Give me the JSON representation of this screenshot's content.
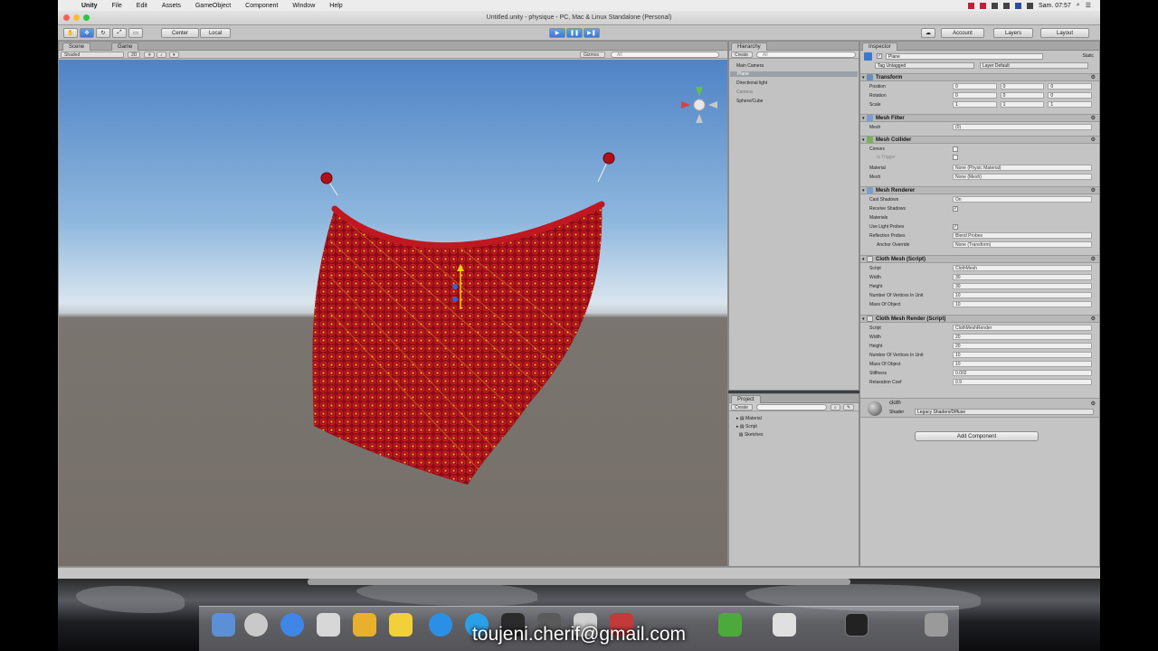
{
  "menubar": {
    "apple": "",
    "app_name": "Unity",
    "items": [
      "File",
      "Edit",
      "Assets",
      "GameObject",
      "Component",
      "Window",
      "Help"
    ],
    "clock": "Sam. 07:57"
  },
  "window": {
    "title": "Untitled.unity - physique - PC, Mac & Linux Standalone (Personal)"
  },
  "toolbar": {
    "tool_hand": "✋",
    "tool_move": "✥",
    "tool_rotate": "↻",
    "tool_scale": "⤢",
    "tool_rect": "▭",
    "pivot": "Center",
    "space": "Local",
    "play": "▶",
    "pause": "❚❚",
    "step": "▶❚",
    "cloud": "☁",
    "account": "Account",
    "layers": "Layers",
    "layout": "Layout"
  },
  "scene": {
    "tab_scene": "Scene",
    "tab_game": "Game",
    "shading": "Shaded",
    "mode_2d": "2D",
    "gizmos": "Gizmos",
    "search_placeholder": "All"
  },
  "hierarchy": {
    "tab": "Hierarchy",
    "create": "Create",
    "search_placeholder": "All",
    "items": [
      {
        "label": "Main Camera",
        "state": "normal"
      },
      {
        "label": "Plane",
        "state": "selected"
      },
      {
        "label": "Directional light",
        "state": "normal"
      },
      {
        "label": "Camera",
        "state": "dim"
      },
      {
        "label": "Sphere/Cube",
        "state": "normal"
      }
    ]
  },
  "project": {
    "tab": "Project",
    "create": "Create",
    "search_placeholder": "",
    "items": [
      "Material",
      "Script",
      "Sketches"
    ]
  },
  "inspector": {
    "tab": "Inspector",
    "object_name": "Plane",
    "static": "Static",
    "tag": "Tag Untagged",
    "layer": "Layer Default",
    "transform": {
      "title": "Transform",
      "position": {
        "label": "Position",
        "x": "0",
        "y": "0",
        "z": "0"
      },
      "rotation": {
        "label": "Rotation",
        "x": "0",
        "y": "0",
        "z": "0"
      },
      "scale": {
        "label": "Scale",
        "x": "1",
        "y": "1",
        "z": "1"
      }
    },
    "mesh_filter": {
      "title": "Mesh Filter",
      "mesh_label": "Mesh",
      "mesh_value": "(0)"
    },
    "mesh_collider": {
      "title": "Mesh Collider",
      "convex": "Convex",
      "trigger": "Is Trigger",
      "material_label": "Material",
      "material_value": "None (Physic Material)",
      "mesh_label": "Mesh",
      "mesh_value": "None (Mesh)"
    },
    "mesh_renderer": {
      "title": "Mesh Renderer",
      "cast_shadows_label": "Cast Shadows",
      "cast_shadows_value": "On",
      "receive_shadows": "Receive Shadows",
      "materials": "Materials",
      "light_probes": "Use Light Probes",
      "reflection_label": "Reflection Probes",
      "reflection_value": "Blend Probes",
      "anchor_label": "Anchor Override",
      "anchor_value": "None (Transform)"
    },
    "cloth_mesh": {
      "title": "Cloth Mesh (Script)",
      "script_label": "Script",
      "script_value": "ClothMesh",
      "width_label": "Width",
      "width_value": "30",
      "height_label": "Height",
      "height_value": "30",
      "vertex_label": "Number Of Vertices In Unit",
      "vertex_value": "10",
      "mass_label": "Mass Of Object",
      "mass_value": "10"
    },
    "cloth_mesh_render": {
      "title": "Cloth Mesh Render (Script)",
      "script_label": "Script",
      "script_value": "ClothMeshRender",
      "width_label": "Width",
      "width_value": "20",
      "height_label": "Height",
      "height_value": "20",
      "vertex_label": "Number Of Vertices In Unit",
      "vertex_value": "10",
      "mass_label": "Mass Of Object",
      "mass_value": "10",
      "stiffness_label": "Stiffness",
      "stiffness_value": "0.002",
      "relax_label": "Relaxation Coef",
      "relax_value": "0.9"
    },
    "material": {
      "name": "cloth",
      "shader_label": "Shader",
      "shader_value": "Legacy Shaders/Diffuse"
    },
    "add_component": "Add Component"
  },
  "watermark": "toujeni.cherif@gmail.com",
  "colors": {
    "cloth": "#b0101a",
    "cloth_highlight": "#f5c400",
    "selection": "#3b78d0"
  }
}
